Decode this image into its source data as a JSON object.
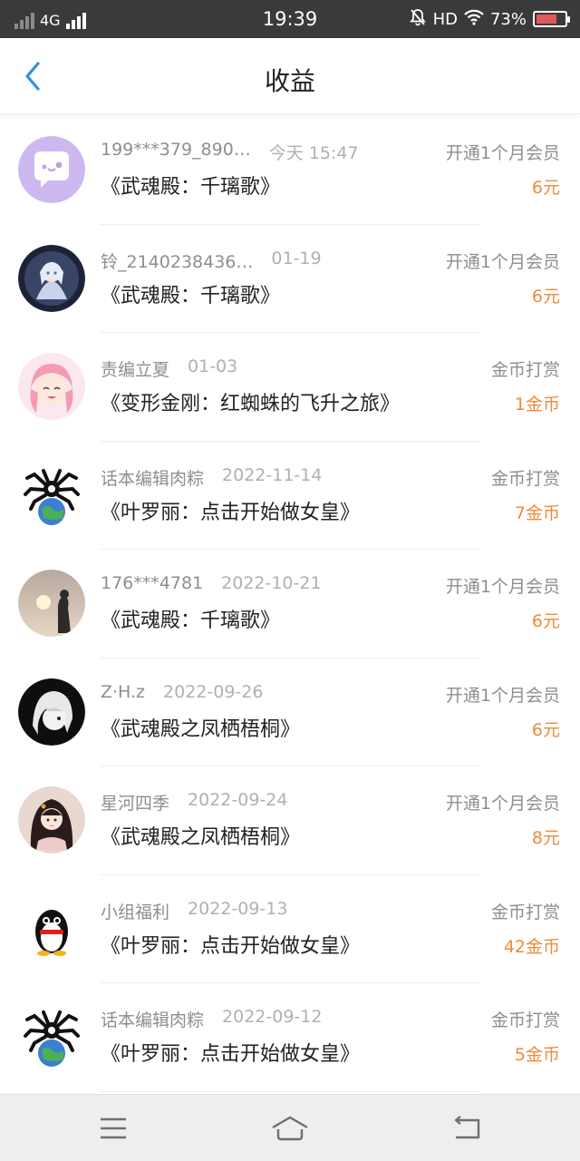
{
  "status_bar": {
    "network": "4G",
    "time": "19:39",
    "hd": "HD",
    "battery": "73%",
    "battery_level": 0.73
  },
  "header": {
    "title": "收益"
  },
  "records": [
    {
      "name": "199***379_890…",
      "date": "今天 15:47",
      "book": "《武魂殿：千璃歌》",
      "type": "开通1个月会员",
      "amount": "6元",
      "avatar": "chat-bubble"
    },
    {
      "name": "铃_2140238436…",
      "date": "01-19",
      "book": "《武魂殿：千璃歌》",
      "type": "开通1个月会员",
      "amount": "6元",
      "avatar": "anime-girl-silver"
    },
    {
      "name": "责编立夏",
      "date": "01-03",
      "book": "《变形金刚：红蜘蛛的飞升之旅》",
      "type": "金币打赏",
      "amount": "1金币",
      "avatar": "anime-girl-pink"
    },
    {
      "name": "话本编辑肉粽",
      "date": "2022-11-14",
      "book": "《叶罗丽：点击开始做女皇》",
      "type": "金币打赏",
      "amount": "7金币",
      "avatar": "spider-earth"
    },
    {
      "name": "176***4781",
      "date": "2022-10-21",
      "book": "《武魂殿：千璃歌》",
      "type": "开通1个月会员",
      "amount": "6元",
      "avatar": "sunset-silhouette"
    },
    {
      "name": "Z·H.z",
      "date": "2022-09-26",
      "book": "《武魂殿之凤栖梧桐》",
      "type": "开通1个月会员",
      "amount": "6元",
      "avatar": "dark-anime"
    },
    {
      "name": "星河四季",
      "date": "2022-09-24",
      "book": "《武魂殿之凤栖梧桐》",
      "type": "开通1个月会员",
      "amount": "8元",
      "avatar": "traditional-girl"
    },
    {
      "name": "小组福利",
      "date": "2022-09-13",
      "book": "《叶罗丽：点击开始做女皇》",
      "type": "金币打赏",
      "amount": "42金币",
      "avatar": "penguin"
    },
    {
      "name": "话本编辑肉粽",
      "date": "2022-09-12",
      "book": "《叶罗丽：点击开始做女皇》",
      "type": "金币打赏",
      "amount": "5金币",
      "avatar": "spider-earth"
    }
  ],
  "nav_bar": {
    "menu_icon": "menu-icon",
    "home_icon": "home-icon",
    "back_icon": "back-icon"
  },
  "colors": {
    "accent_blue": "#2f8fe8",
    "amount_orange": "#f08a3a",
    "status_bar_bg": "#3a3a3a"
  }
}
